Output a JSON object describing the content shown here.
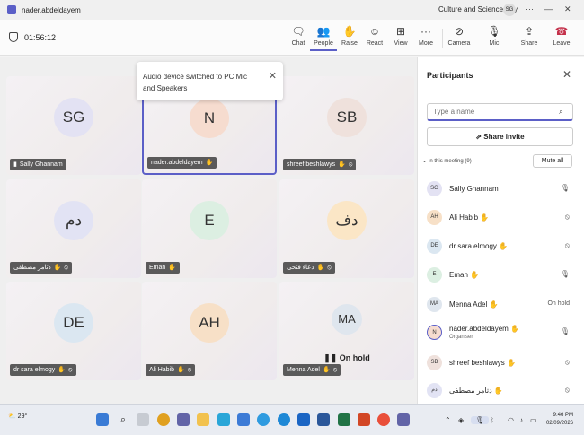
{
  "titlebar": {
    "user": "nader.abdeldayem",
    "org": "Culture and Science City",
    "org_initials": "SG"
  },
  "toolbar": {
    "timer": "01:56:12",
    "buttons": {
      "chat": "Chat",
      "people": "People",
      "raise": "Raise",
      "react": "React",
      "view": "View",
      "more": "More",
      "camera": "Camera",
      "mic": "Mic",
      "share": "Share",
      "leave": "Leave"
    }
  },
  "toast": {
    "message": "Audio device switched to PC Mic and Speakers"
  },
  "tiles": [
    {
      "initials": "SG",
      "name": "Sally Ghannam",
      "color": "#e3e2f3"
    },
    {
      "initials": "N",
      "name": "nader.abdeldayem",
      "color": "#f6dccf"
    },
    {
      "initials": "SB",
      "name": "shreef beshlawys",
      "color": "#efe1dc"
    },
    {
      "initials": "دم",
      "name": "دتامر مصطفى",
      "color": "#e2e3f4"
    },
    {
      "initials": "E",
      "name": "Eman",
      "color": "#dcefe2"
    },
    {
      "initials": "دف",
      "name": "دعاء فتحى",
      "color": "#fbe6c6"
    },
    {
      "initials": "DE",
      "name": "dr sara elmogy",
      "color": "#dbe7f1"
    },
    {
      "initials": "AH",
      "name": "Ali Habib",
      "color": "#f7e0c7"
    },
    {
      "initials": "MA",
      "name": "Menna Adel",
      "color": "#dfe6ee",
      "status": "On hold"
    }
  ],
  "panel": {
    "title": "Participants",
    "search_placeholder": "Type a name",
    "share_invite": "Share invite",
    "in_meeting": "In this meeting (9)",
    "mute_all": "Mute all",
    "participants": [
      {
        "initials": "SG",
        "name": "Sally Ghannam",
        "color": "#e3e2f3",
        "status": "mic"
      },
      {
        "initials": "AH",
        "name": "Ali Habib",
        "color": "#f7e0c7",
        "status": "mic-off"
      },
      {
        "initials": "DE",
        "name": "dr sara elmogy",
        "color": "#dbe7f1",
        "status": "mic-off"
      },
      {
        "initials": "E",
        "name": "Eman",
        "color": "#dcefe2",
        "status": "mic"
      },
      {
        "initials": "MA",
        "name": "Menna Adel",
        "color": "#dfe6ee",
        "status_text": "On hold"
      },
      {
        "initials": "N",
        "name": "nader.abdeldayem",
        "sub": "Organiser",
        "color": "#f6dccf",
        "status": "mic"
      },
      {
        "initials": "SB",
        "name": "shreef beshlawys",
        "color": "#efe1dc",
        "status": "mic-off"
      },
      {
        "initials": "دم",
        "name": "دتامر مصطفى",
        "color": "#e2e3f4",
        "status": "mic-off"
      }
    ]
  },
  "taskbar": {
    "temperature": "29°",
    "time": "9:46 PM",
    "date": "02/09/2026"
  },
  "colors": {
    "accent": "#5b5fc7",
    "leave": "#c4314b"
  }
}
